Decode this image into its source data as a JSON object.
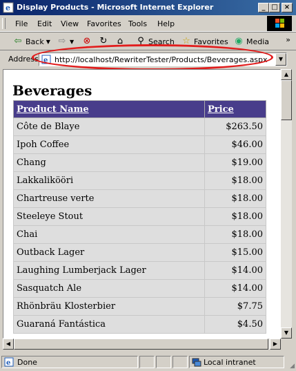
{
  "window": {
    "title": "Display Products - Microsoft Internet Explorer"
  },
  "menu": [
    "File",
    "Edit",
    "View",
    "Favorites",
    "Tools",
    "Help"
  ],
  "toolbar": {
    "back": "Back",
    "search": "Search",
    "favorites": "Favorites",
    "media": "Media"
  },
  "address": {
    "label": "Address",
    "url": "http://localhost/RewriterTester/Products/Beverages.aspx"
  },
  "page": {
    "heading": "Beverages",
    "columns": [
      "Product Name",
      "Price"
    ],
    "rows": [
      [
        "Côte de Blaye",
        "$263.50"
      ],
      [
        "Ipoh Coffee",
        "$46.00"
      ],
      [
        "Chang",
        "$19.00"
      ],
      [
        "Lakkalikööri",
        "$18.00"
      ],
      [
        "Chartreuse verte",
        "$18.00"
      ],
      [
        "Steeleye Stout",
        "$18.00"
      ],
      [
        "Chai",
        "$18.00"
      ],
      [
        "Outback Lager",
        "$15.00"
      ],
      [
        "Laughing Lumberjack Lager",
        "$14.00"
      ],
      [
        "Sasquatch Ale",
        "$14.00"
      ],
      [
        "Rhönbräu Klosterbier",
        "$7.75"
      ],
      [
        "Guaraná Fantástica",
        "$4.50"
      ]
    ]
  },
  "status": {
    "left": "Done",
    "zone": "Local intranet"
  },
  "colors": {
    "header_bg": "#483d8b",
    "row_bg": "#dedede",
    "annotation": "#e21c1c"
  }
}
